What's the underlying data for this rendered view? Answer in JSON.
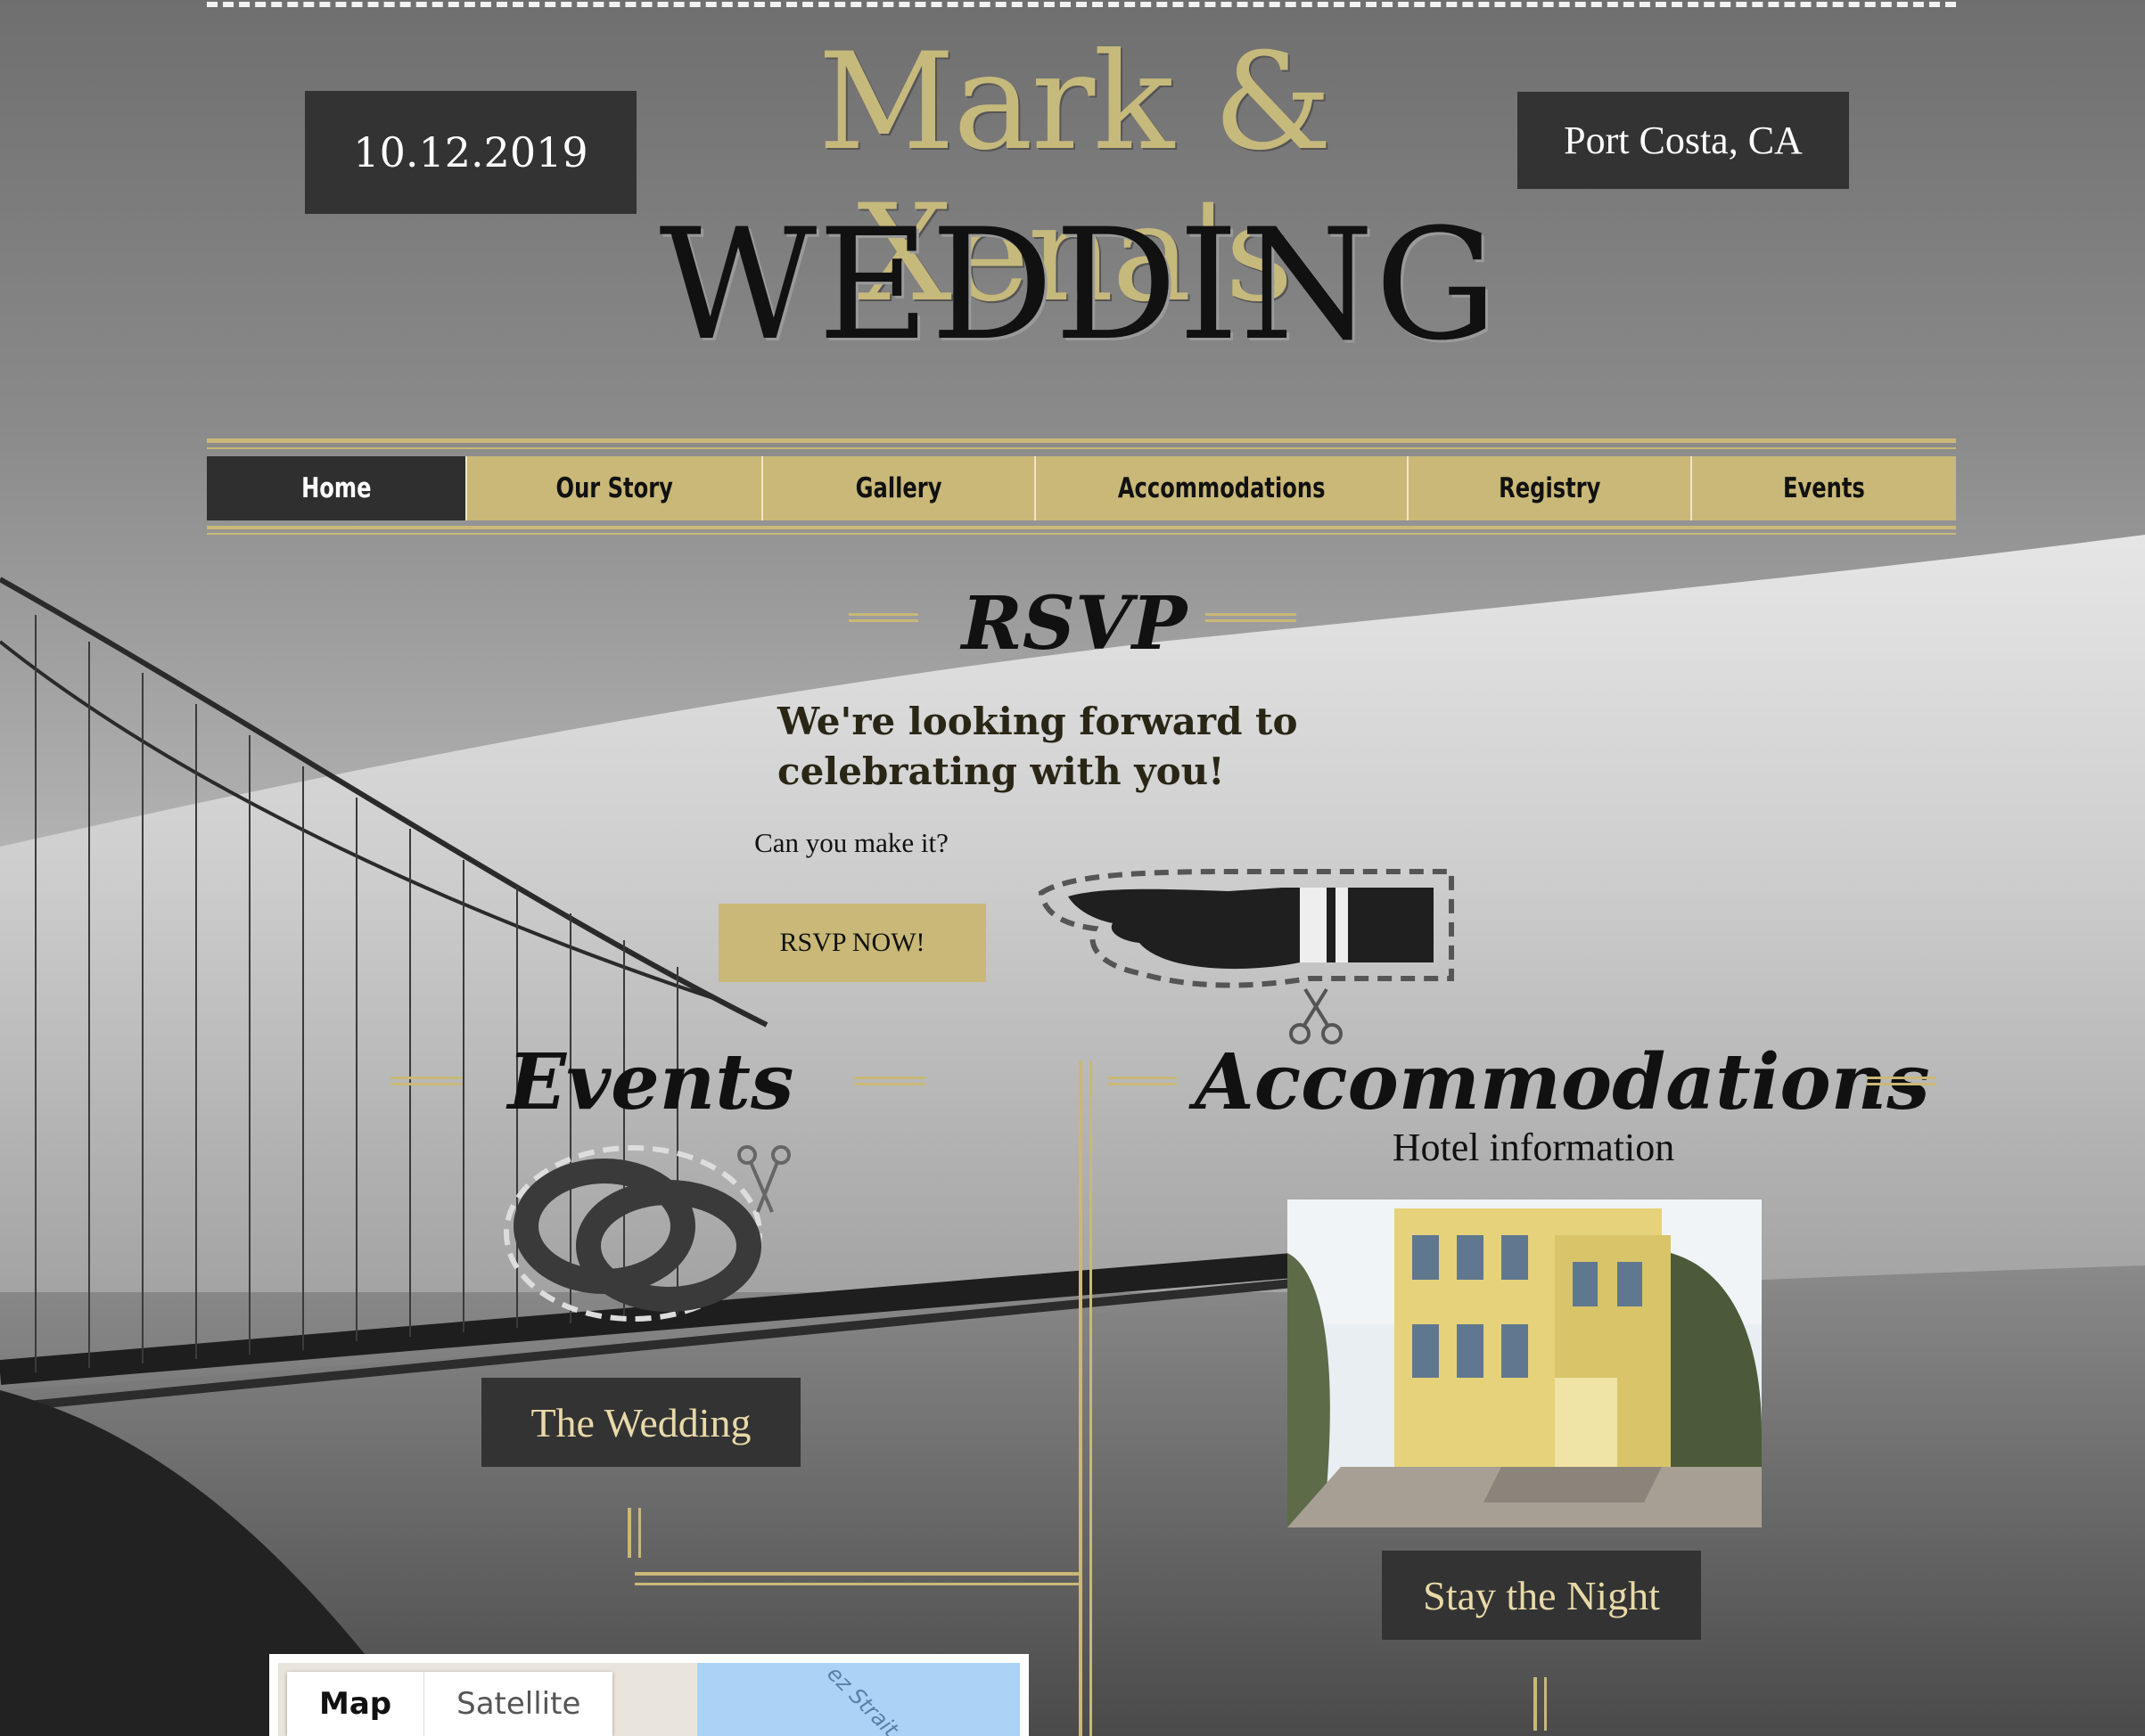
{
  "header": {
    "date": "10.12.2019",
    "location": "Port Costa, CA",
    "couple": "Mark & Xena's",
    "title": "WEDDING"
  },
  "nav": {
    "items": [
      {
        "label": "Home",
        "active": true
      },
      {
        "label": "Our Story"
      },
      {
        "label": "Gallery"
      },
      {
        "label": "Accommodations"
      },
      {
        "label": "Registry"
      },
      {
        "label": "Events"
      }
    ]
  },
  "rsvp": {
    "title": "RSVP",
    "message": "We're looking forward to celebrating with you!",
    "question": "Can you make it?",
    "button": "RSVP NOW!"
  },
  "events": {
    "title": "Events",
    "button": "The Wedding"
  },
  "accommodations": {
    "title": "Accommodations",
    "subtitle": "Hotel information",
    "button": "Stay the Night"
  },
  "map": {
    "tabs": [
      {
        "label": "Map",
        "active": true
      },
      {
        "label": "Satellite"
      }
    ],
    "water_label": "ez Strait"
  },
  "icons": {
    "hand": "pointing-hand-icon",
    "rings": "wedding-rings-icon",
    "scissors": "scissors-icon"
  },
  "colors": {
    "gold": "#c9b877",
    "dark": "#333333",
    "title_gold": "#c6b97c"
  }
}
